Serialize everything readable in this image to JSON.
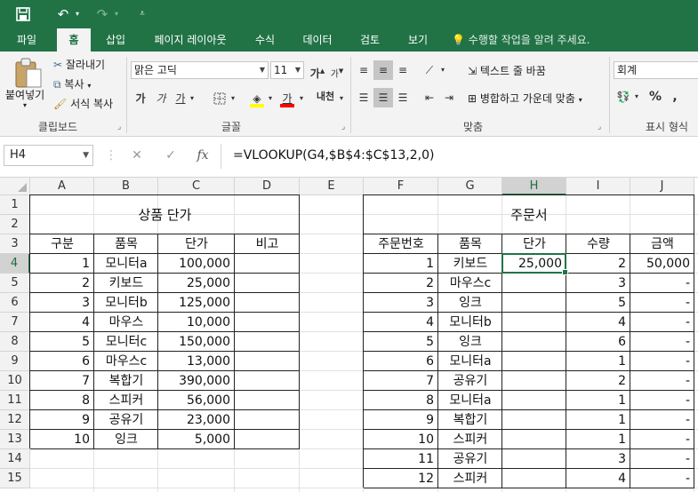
{
  "qat": {
    "save_icon": "save-icon",
    "undo_icon": "undo-icon",
    "redo_icon": "redo-icon",
    "customize_icon": "customize-qat-icon"
  },
  "tabs": [
    "파일",
    "홈",
    "삽입",
    "페이지 레이아웃",
    "수식",
    "데이터",
    "검토",
    "보기"
  ],
  "active_tab": "홈",
  "tell_me": "수행할 작업을 알려 주세요.",
  "ribbon": {
    "clipboard": {
      "paste": "붙여넣기",
      "cut": "잘라내기",
      "copy": "복사",
      "format_painter": "서식 복사",
      "label": "클립보드"
    },
    "font": {
      "font_name": "맑은 고딕",
      "font_size": "11",
      "grow": "가",
      "shrink": "가",
      "bold": "가",
      "italic": "가",
      "underline": "가",
      "phonetic": "내천",
      "label": "글꼴",
      "fill_color": "#ffff00",
      "font_color": "#ff0000"
    },
    "alignment": {
      "wrap_text": "텍스트 줄 바꿈",
      "merge_center": "병합하고 가운데 맞춤",
      "label": "맞춤"
    },
    "number": {
      "format": "회계",
      "percent": "%",
      "comma": ",",
      "label": "표시 형식"
    }
  },
  "formula_bar": {
    "name_box": "H4",
    "cancel": "✕",
    "enter": "✓",
    "fx": "fx",
    "formula": "=VLOOKUP(G4,$B$4:$C$13,2,0)"
  },
  "columns": [
    "A",
    "B",
    "C",
    "D",
    "E",
    "F",
    "G",
    "H",
    "I",
    "J"
  ],
  "rows": [
    "1",
    "2",
    "3",
    "4",
    "5",
    "6",
    "7",
    "8",
    "9",
    "10",
    "11",
    "12",
    "13",
    "14",
    "15"
  ],
  "price_table": {
    "title": "상품 단가",
    "headers": [
      "구분",
      "품목",
      "단가",
      "비고"
    ],
    "rows": [
      [
        "1",
        "모니터a",
        "100,000",
        ""
      ],
      [
        "2",
        "키보드",
        "25,000",
        ""
      ],
      [
        "3",
        "모니터b",
        "125,000",
        ""
      ],
      [
        "4",
        "마우스",
        "10,000",
        ""
      ],
      [
        "5",
        "모니터c",
        "150,000",
        ""
      ],
      [
        "6",
        "마우스c",
        "13,000",
        ""
      ],
      [
        "7",
        "복합기",
        "390,000",
        ""
      ],
      [
        "8",
        "스피커",
        "56,000",
        ""
      ],
      [
        "9",
        "공유기",
        "23,000",
        ""
      ],
      [
        "10",
        "잉크",
        "5,000",
        ""
      ]
    ]
  },
  "order_table": {
    "title": "주문서",
    "headers": [
      "주문번호",
      "품목",
      "단가",
      "수량",
      "금액"
    ],
    "rows": [
      [
        "1",
        "키보드",
        "25,000",
        "2",
        "50,000"
      ],
      [
        "2",
        "마우스c",
        "",
        "3",
        "-"
      ],
      [
        "3",
        "잉크",
        "",
        "5",
        "-"
      ],
      [
        "4",
        "모니터b",
        "",
        "4",
        "-"
      ],
      [
        "5",
        "잉크",
        "",
        "6",
        "-"
      ],
      [
        "6",
        "모니터a",
        "",
        "1",
        "-"
      ],
      [
        "7",
        "공유기",
        "",
        "2",
        "-"
      ],
      [
        "8",
        "모니터a",
        "",
        "1",
        "-"
      ],
      [
        "9",
        "복합기",
        "",
        "1",
        "-"
      ],
      [
        "10",
        "스피커",
        "",
        "1",
        "-"
      ],
      [
        "11",
        "공유기",
        "",
        "3",
        "-"
      ],
      [
        "12",
        "스피커",
        "",
        "4",
        "-"
      ]
    ]
  },
  "selected_cell": "H4",
  "accent": "#217346"
}
